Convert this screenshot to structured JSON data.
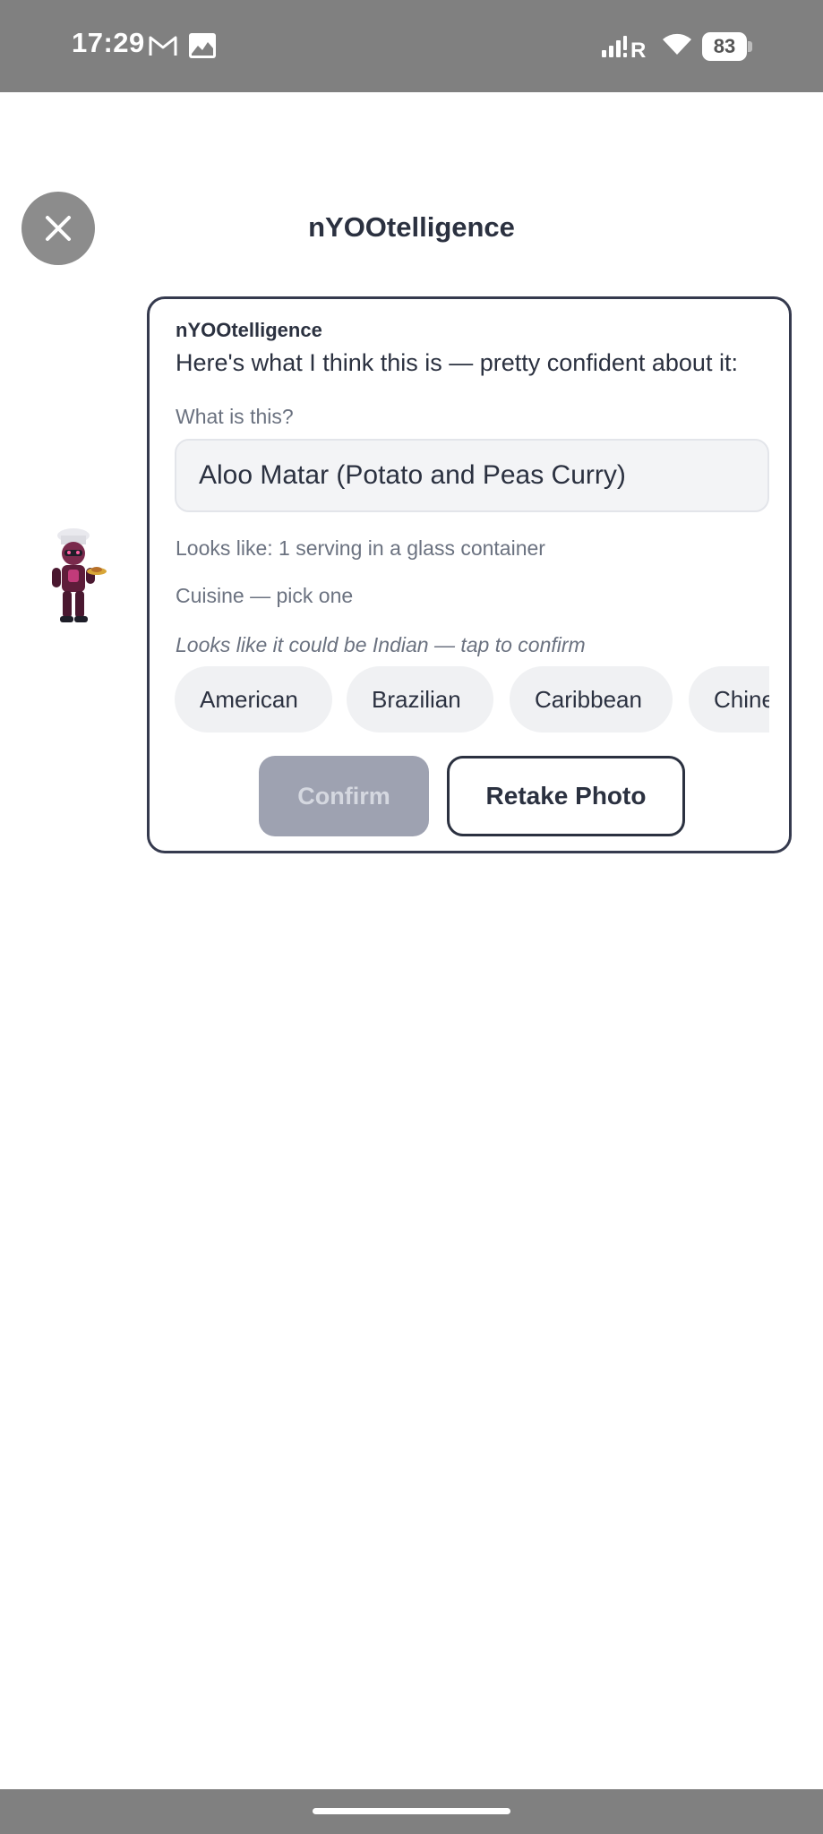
{
  "status_bar": {
    "time": "17:29",
    "icons": [
      "gmail-icon",
      "gallery-icon",
      "signal-icon",
      "wifi-icon",
      "battery-icon"
    ],
    "battery_level": "83"
  },
  "header": {
    "title": "nYOOtelligence",
    "close_icon": "close-icon"
  },
  "chat": {
    "sender": "nYOOtelligence",
    "message": "Here's what I think this is — pretty confident about it:",
    "what_label": "What is this?",
    "food_name": "Aloo Matar (Potato and Peas Curry)",
    "looks_like": "Looks like: 1 serving in a glass container",
    "cuisine_label": "Cuisine — pick one",
    "cuisine_hint": "Looks like it could be Indian — tap to confirm",
    "cuisines": [
      "American",
      "Brazilian",
      "Caribbean",
      "Chinese"
    ],
    "confirm_label": "Confirm",
    "retake_label": "Retake Photo"
  },
  "colors": {
    "accent": "#2b3140",
    "disabled_button": "#9ea2b1",
    "chip_bg": "#f0f1f3",
    "status_bar": "#808080"
  }
}
